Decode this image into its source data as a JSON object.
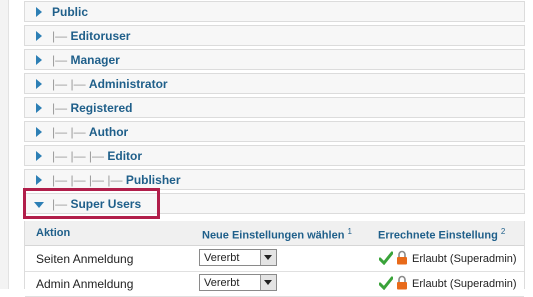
{
  "groups": [
    {
      "indent": "",
      "label": "Public"
    },
    {
      "indent": "|— ",
      "label": "Editoruser"
    },
    {
      "indent": "|— ",
      "label": "Manager"
    },
    {
      "indent": "|— |— ",
      "label": "Administrator"
    },
    {
      "indent": "|— ",
      "label": "Registered"
    },
    {
      "indent": "|— |— ",
      "label": "Author"
    },
    {
      "indent": "|— |— |— ",
      "label": "Editor"
    },
    {
      "indent": "|— |— |— |— ",
      "label": "Publisher"
    },
    {
      "indent": "|— ",
      "label": "Super Users"
    }
  ],
  "table": {
    "col_action": "Aktion",
    "col_new": "Neue Einstellungen wählen",
    "col_new_note": "1",
    "col_calc": "Errechnete Einstellung",
    "col_calc_note": "2",
    "rows": [
      {
        "action": "Seiten Anmeldung",
        "select": "Vererbt",
        "result": "Erlaubt (Superadmin)"
      },
      {
        "action": "Admin Anmeldung",
        "select": "Vererbt",
        "result": "Erlaubt (Superadmin)"
      }
    ]
  },
  "colors": {
    "accent": "#1f5f8a",
    "highlight": "#b11e4a",
    "arrow": "#2d7fb5"
  }
}
